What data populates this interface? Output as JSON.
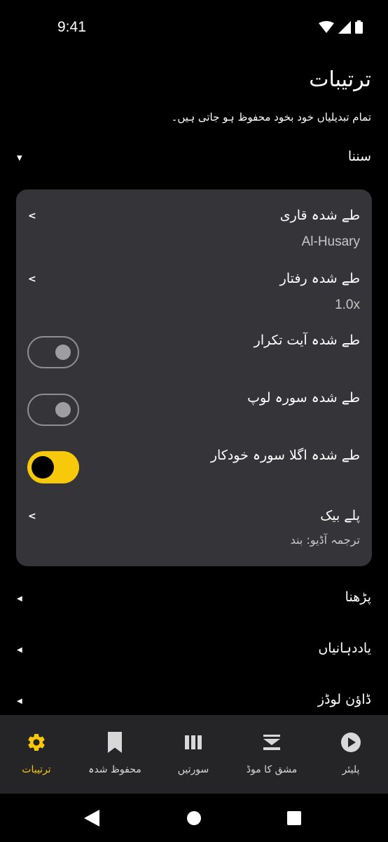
{
  "status_bar": {
    "time": "9:41"
  },
  "header": {
    "title": "ترتیبات",
    "subtitle": "تمام تبدیلیاں خود بخود محفوظ ہو جاتی ہیں۔"
  },
  "sections": {
    "listen": {
      "title": "سننا",
      "expanded": true
    },
    "reading": {
      "title": "پڑھنا",
      "expanded": false
    },
    "reminders": {
      "title": "یاددہانیاں",
      "expanded": false
    },
    "downloads": {
      "title": "ڈاؤن لوڈز",
      "expanded": false
    }
  },
  "listen_items": {
    "reciter": {
      "title": "طے شدہ قاری",
      "value": "Al-Husary"
    },
    "speed": {
      "title": "طے شدہ رفتار",
      "value": "1.0x"
    },
    "ayah_repeat": {
      "title": "طے شدہ آیت تکرار",
      "on": false
    },
    "surah_loop": {
      "title": "طے شدہ سورہ لوپ",
      "on": false
    },
    "auto_next": {
      "title": "طے شدہ اگلا سورہ خودکار",
      "on": true
    },
    "playback": {
      "title": "پلے بیک",
      "value": "ترجمہ آڈیو: بند"
    }
  },
  "bottom_nav": {
    "settings": "ترتیبات",
    "saved": "محفوظ شدہ",
    "surahs": "سورتیں",
    "practice": "مشق کا موڈ",
    "player": "پلیئر",
    "active": "settings"
  },
  "colors": {
    "accent": "#f7c90a",
    "card": "#353539",
    "nav_bg": "#252528",
    "background": "#000000"
  }
}
